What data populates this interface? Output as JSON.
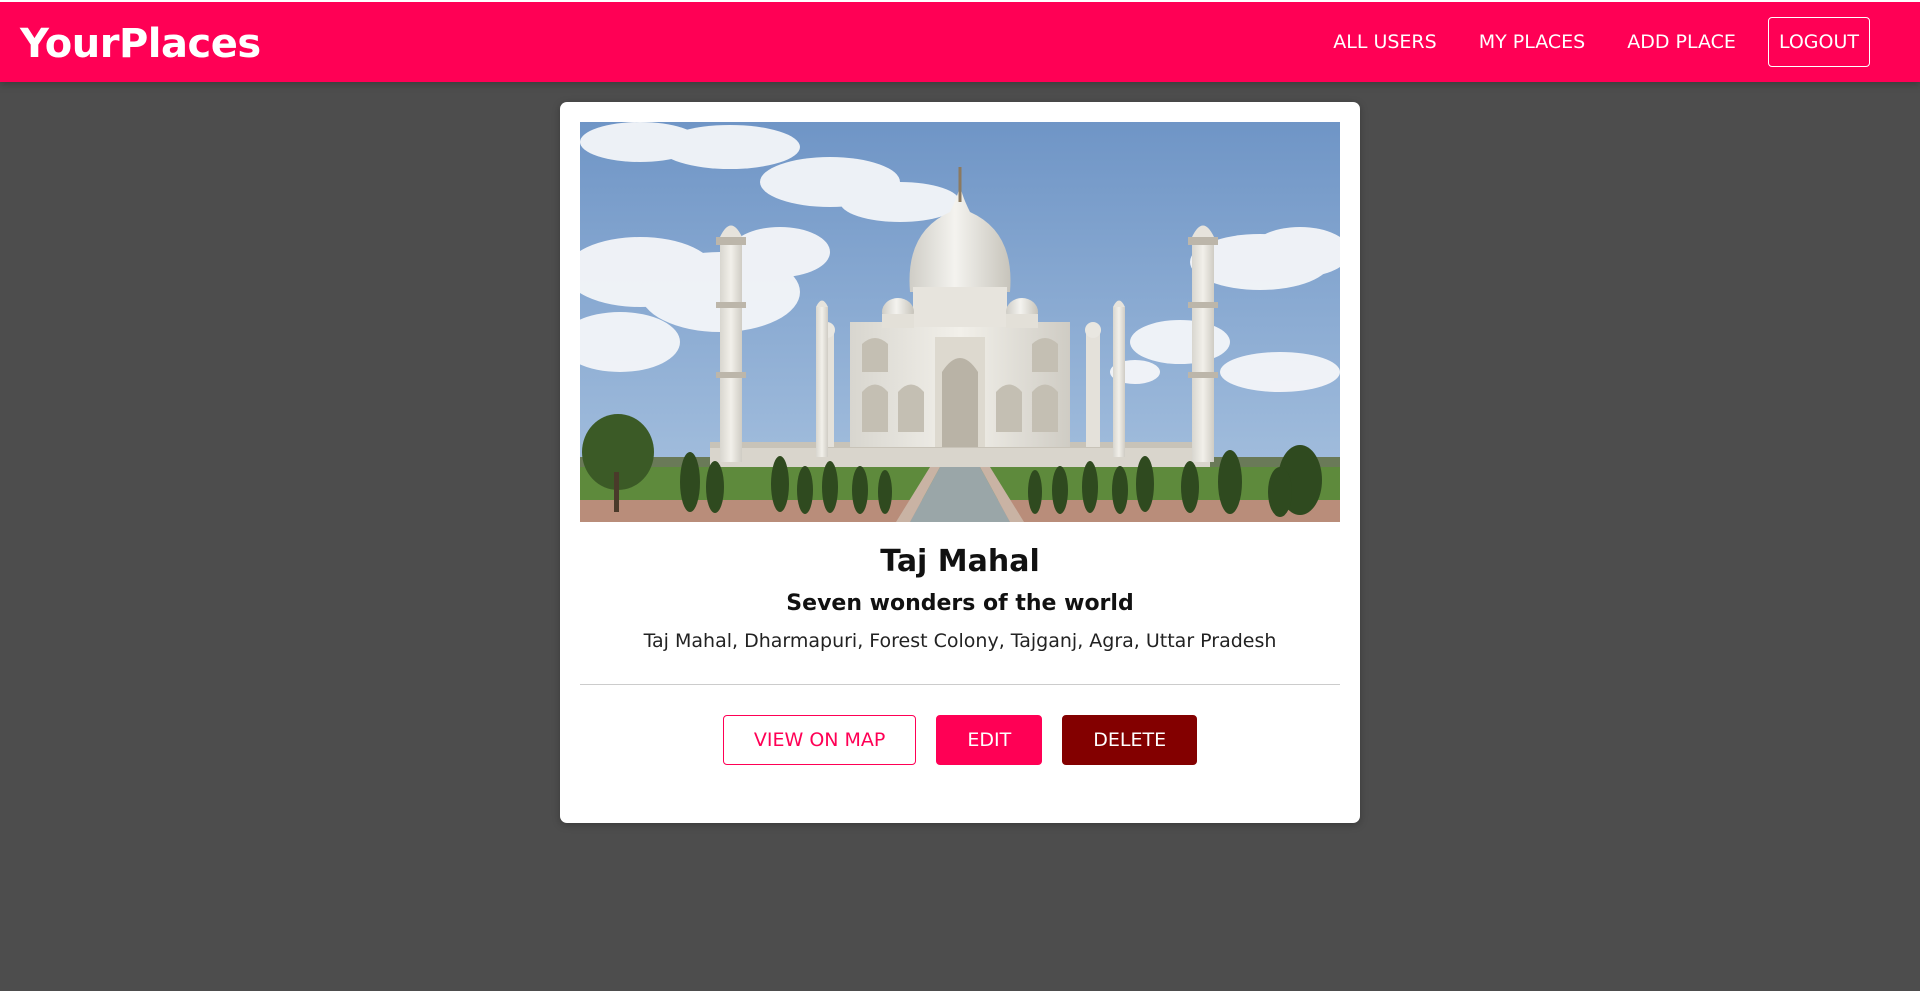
{
  "header": {
    "logo": "YourPlaces",
    "nav": {
      "all_users": "ALL USERS",
      "my_places": "MY PLACES",
      "add_place": "ADD PLACE",
      "logout": "LOGOUT"
    }
  },
  "place": {
    "title": "Taj Mahal",
    "subtitle": "Seven wonders of the world",
    "address": "Taj Mahal, Dharmapuri, Forest Colony, Tajganj, Agra, Uttar Pradesh",
    "image_icon": "taj-mahal-photo"
  },
  "actions": {
    "view_on_map": "VIEW ON MAP",
    "edit": "EDIT",
    "delete": "DELETE"
  },
  "colors": {
    "brand": "#ff0055",
    "danger": "#830000",
    "page_background": "#4d4d4d"
  }
}
